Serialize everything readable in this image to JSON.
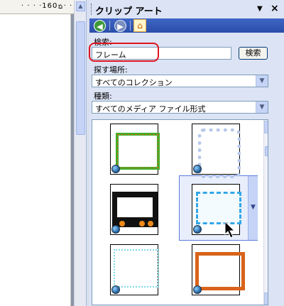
{
  "document": {
    "ruler_text": "· · · ·160· · · · · ·"
  },
  "pane": {
    "title": "クリップ アート",
    "dropdown_glyph": "▼",
    "close_glyph": "×",
    "toolbar": {
      "back_icon": "back-arrow-icon",
      "forward_icon": "forward-arrow-icon",
      "home_icon": "home-icon"
    },
    "search": {
      "label": "検索:",
      "value": "フレーム",
      "button": "検索"
    },
    "location": {
      "label": "探す場所:",
      "value": "すべてのコレクション"
    },
    "type": {
      "label": "種類:",
      "value": "すべてのメディア ファイル形式"
    },
    "results": {
      "items": [
        {
          "kind": "green-flower-frame"
        },
        {
          "kind": "blue-lace-frame"
        },
        {
          "kind": "halloween-frame"
        },
        {
          "kind": "blue-dotted-frame",
          "selected": true
        },
        {
          "kind": "cyan-lace-frame"
        },
        {
          "kind": "orange-brick-frame"
        }
      ]
    }
  },
  "colors": {
    "pane_bg": "#dbe3f5",
    "toolbar_blue": "#2a4ea8",
    "highlight_red": "#e0141e"
  }
}
